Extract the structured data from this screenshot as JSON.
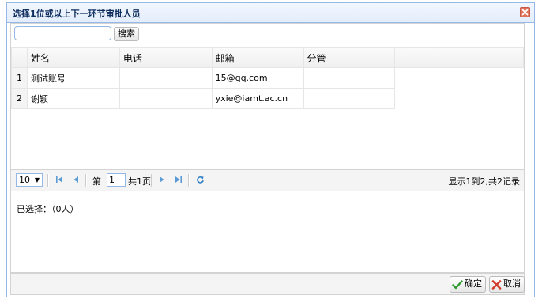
{
  "dialog": {
    "title": "选择1位或以上下一环节审批人员",
    "close_icon": "close-icon"
  },
  "search": {
    "value": "",
    "placeholder": "",
    "button_label": "搜索"
  },
  "table": {
    "columns": [
      "姓名",
      "电话",
      "邮箱",
      "分管"
    ],
    "rows": [
      {
        "num": "1",
        "name": "测试账号",
        "phone": "",
        "email": "15@qq.com",
        "dept": ""
      },
      {
        "num": "2",
        "name": "谢颖",
        "phone": "",
        "email": "yxie@iamt.ac.cn",
        "dept": ""
      }
    ]
  },
  "pager": {
    "page_size": "10",
    "page_label_prefix": "第",
    "page_value": "1",
    "page_total": "共1页",
    "info": "显示1到2,共2记录"
  },
  "selected": {
    "label": "已选择：（0人）"
  },
  "footer": {
    "ok_label": "确定",
    "cancel_label": "取消"
  },
  "colors": {
    "border_blue": "#95b8e7",
    "pager_icon_blue": "#5b9bd5",
    "close_red": "#e0735b",
    "ok_green": "#2e9b2e",
    "cancel_red": "#d23b2a"
  }
}
